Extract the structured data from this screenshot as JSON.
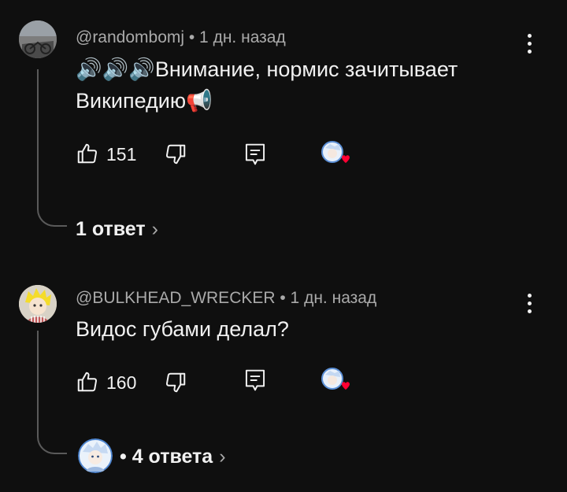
{
  "comments": [
    {
      "author_meta": "@randombomj • 1 дн. назад",
      "text_line1": "🔊🔊🔊Внимание, нормис зачитывает",
      "text_line2": "Википедию📢",
      "likes": "151",
      "replies_label": "1 ответ",
      "chevron": "›"
    },
    {
      "author_meta": "@BULKHEAD_WRECKER • 1 дн. назад",
      "text_line1": "Видос губами делал?",
      "likes": "160",
      "replies_label": "• 4 ответа",
      "chevron": "›"
    }
  ],
  "icons": {
    "like": "thumbs-up-icon",
    "dislike": "thumbs-down-icon",
    "reply": "reply-comment-icon",
    "more": "more-vertical-icon",
    "creator_heart": "creator-heart-icon"
  },
  "colors": {
    "background": "#0f0f0f",
    "text": "#f1f1f1",
    "secondary": "#aaaaaa",
    "heart": "#ff0033",
    "thread": "#5a5a5a"
  }
}
